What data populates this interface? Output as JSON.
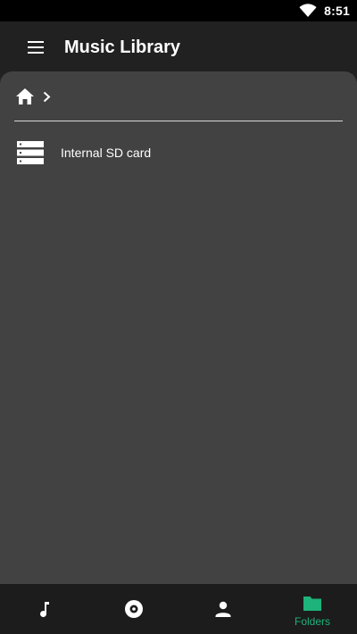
{
  "status_bar": {
    "time": "8:51"
  },
  "app_bar": {
    "title": "Music Library",
    "menu_icon": "hamburger-menu-icon"
  },
  "breadcrumb": {
    "home_icon": "home-icon",
    "separator_icon": "chevron-right-icon"
  },
  "folders": [
    {
      "label": "Internal SD card",
      "icon": "storage-icon"
    }
  ],
  "bottom_nav": {
    "items": [
      {
        "icon": "music-note-icon",
        "label": ""
      },
      {
        "icon": "album-icon",
        "label": ""
      },
      {
        "icon": "person-icon",
        "label": ""
      },
      {
        "icon": "folder-icon",
        "label": "Folders",
        "active": true
      }
    ]
  },
  "colors": {
    "accent": "#1db37a",
    "background": "#424242",
    "app_bar": "#212121",
    "status_bar": "#000000",
    "bottom_nav": "#1c1c1c",
    "icon": "#ffffff"
  }
}
